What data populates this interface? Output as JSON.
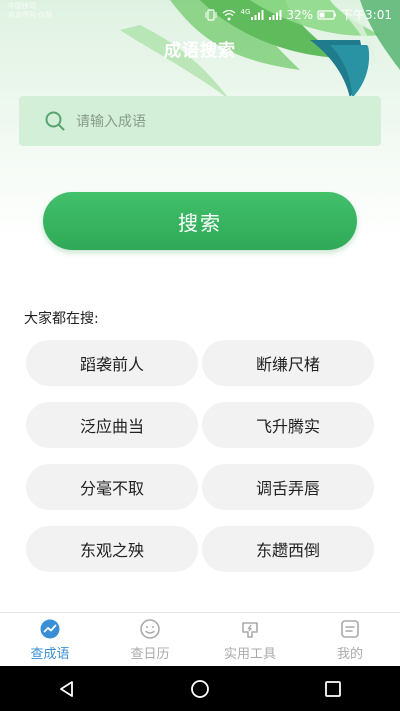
{
  "status_bar": {
    "carrier_line1": "中国移动",
    "carrier_line2": "紧急呼叫·仅限",
    "net_label": "4G",
    "battery": "32%",
    "time": "下午3:01"
  },
  "header": {
    "title": "成语搜索"
  },
  "search": {
    "placeholder": "请输入成语",
    "button_label": "搜索"
  },
  "hot": {
    "label": "大家都在搜:",
    "items": [
      "蹈袭前人",
      "断缣尺楮",
      "泛应曲当",
      "飞升腾实",
      "分毫不取",
      "调舌弄唇",
      "东观之殃",
      "东趱西倒"
    ]
  },
  "tabs": [
    {
      "label": "查成语",
      "icon": "idiom-search-icon",
      "active": true
    },
    {
      "label": "查日历",
      "icon": "calendar-icon",
      "active": false
    },
    {
      "label": "实用工具",
      "icon": "tools-icon",
      "active": false
    },
    {
      "label": "我的",
      "icon": "profile-icon",
      "active": false
    }
  ],
  "colors": {
    "accent_green": "#3bb863",
    "active_tab": "#3a8ed6",
    "inactive_tab": "#aaaaaa",
    "search_bg": "#d3efd7",
    "chip_bg": "#f2f2f2"
  }
}
